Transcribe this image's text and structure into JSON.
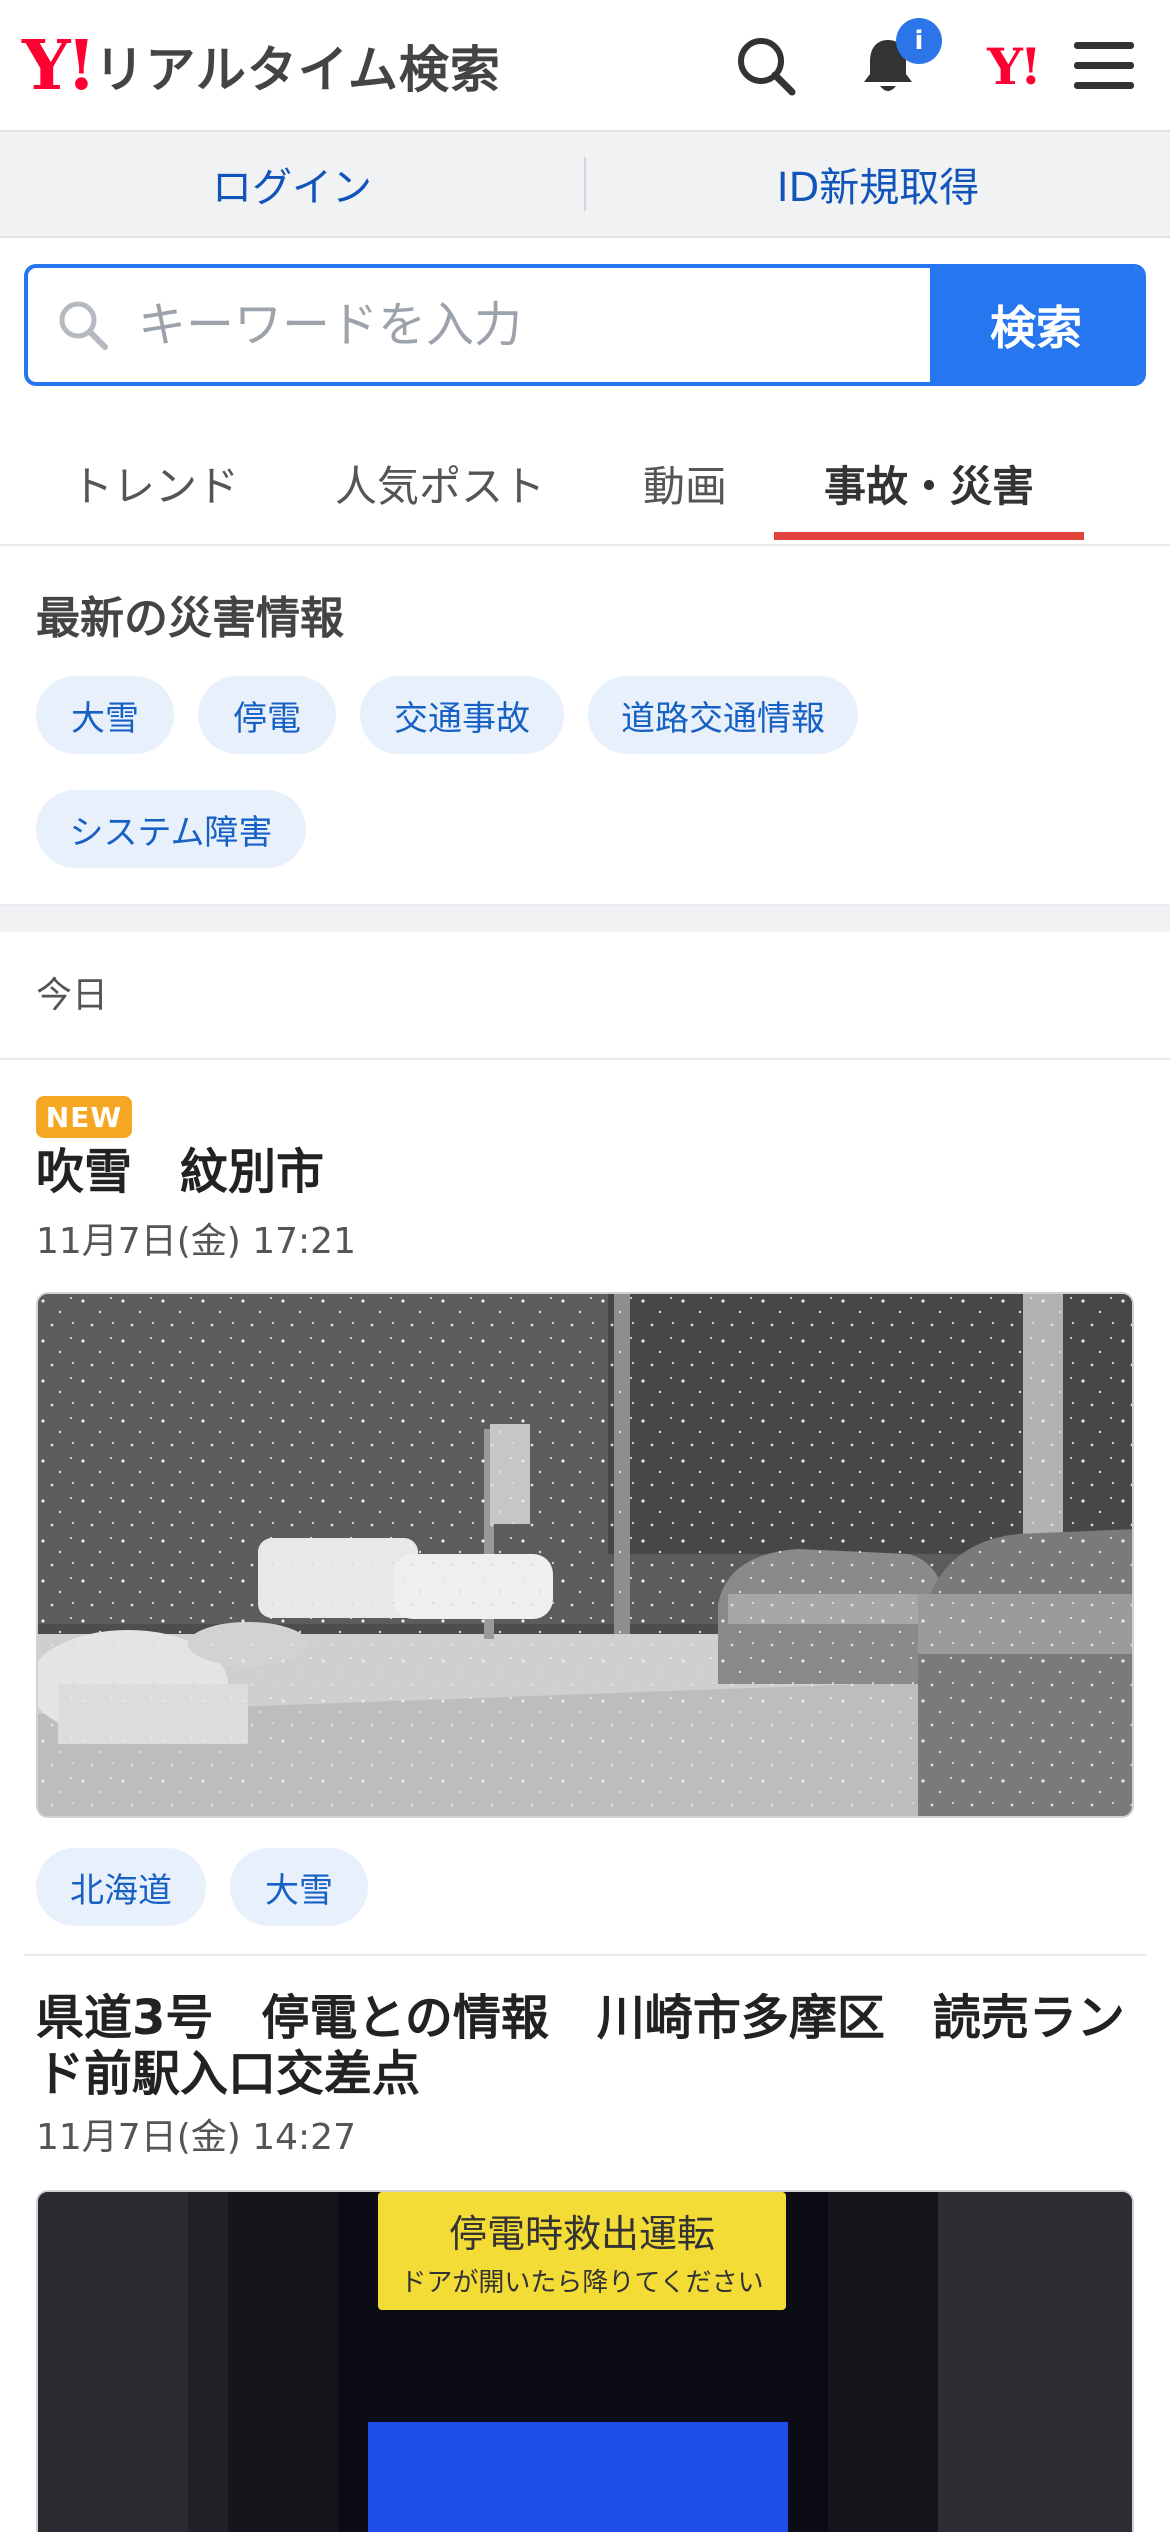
{
  "header": {
    "logo_mark": "Y!",
    "logo_text": "リアルタイム検索",
    "notification_badge": "i",
    "yahoo_mark": "Y!"
  },
  "login_bar": {
    "login": "ログイン",
    "register": "ID新規取得"
  },
  "search": {
    "placeholder": "キーワードを入力",
    "button": "検索"
  },
  "tabs": [
    {
      "label": "トレンド",
      "active": false
    },
    {
      "label": "人気ポスト",
      "active": false
    },
    {
      "label": "動画",
      "active": false
    },
    {
      "label": "事故・災害",
      "active": true
    }
  ],
  "disaster_section": {
    "title": "最新の災害情報",
    "chips": [
      "大雪",
      "停電",
      "交通事故",
      "道路交通情報",
      "システム障害"
    ]
  },
  "day_label": "今日",
  "posts": [
    {
      "badge": "NEW",
      "title": "吹雪　紋別市",
      "time": "11月7日(金) 17:21",
      "tags": [
        "北海道",
        "大雪"
      ]
    },
    {
      "title": "県道3号　停電との情報　川崎市多摩区　読売ランド前駅入口交差点",
      "time": "11月7日(金) 14:27",
      "image_sign_line1": "停電時救出運転",
      "image_sign_line2": "ドアが開いたら降りてください"
    }
  ],
  "colors": {
    "accent": "#2676f0",
    "brand_red": "#ff0033",
    "tab_underline": "#e0443a",
    "chip_bg": "#e8f0fb",
    "chip_text": "#1760c4",
    "new_badge": "#f5a623"
  }
}
